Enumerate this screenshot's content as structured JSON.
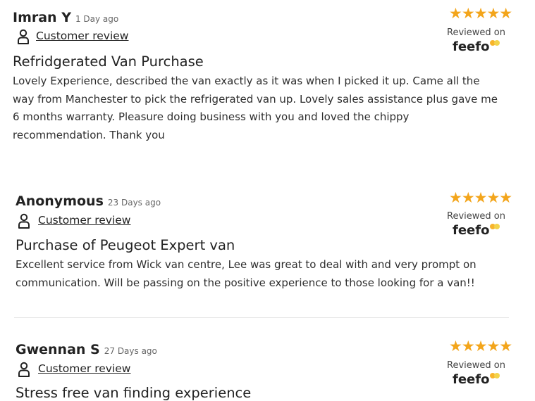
{
  "brand": {
    "star_color": "#f3a51b",
    "feefo_dot_colors": [
      "#f7b42c",
      "#f3d34a"
    ]
  },
  "reviews": [
    {
      "author": "Imran Y",
      "time_ago": "1 Day ago",
      "type_label": "Customer review",
      "type_icon": "person-icon",
      "title": "Refridgerated Van Purchase",
      "body": "Lovely Experience, described the van exactly as it was when I picked it up. Came all the way from Manchester to pick the refrigerated van up. Lovely sales assistance plus gave me 6 months warranty. Pleasure doing business with you and loved the chippy recommendation. Thank you",
      "stars": "★★★★★",
      "rating": 5,
      "reviewed_on": "Reviewed on",
      "platform": "feefo"
    },
    {
      "author": "Anonymous",
      "time_ago": "23 Days ago",
      "type_label": "Customer review",
      "type_icon": "person-icon",
      "title": "Purchase of Peugeot Expert van",
      "body": "Excellent service from Wick van centre, Lee was great to deal with and very prompt on communication. Will be passing on the positive experience to those looking for a van!!",
      "stars": "★★★★★",
      "rating": 5,
      "reviewed_on": "Reviewed on",
      "platform": "feefo"
    },
    {
      "author": "Gwennan S",
      "time_ago": "27 Days ago",
      "type_label": "Customer review",
      "type_icon": "person-icon",
      "title": "Stress free van finding experience",
      "body": "",
      "stars": "★★★★★",
      "rating": 5,
      "reviewed_on": "Reviewed on",
      "platform": "feefo"
    }
  ]
}
